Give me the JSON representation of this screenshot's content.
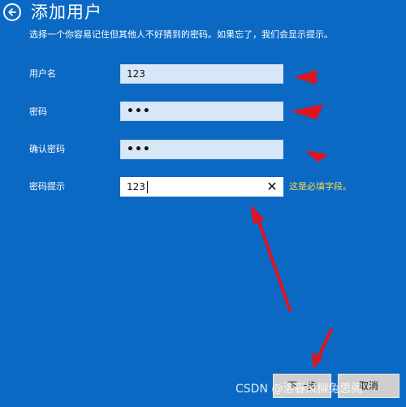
{
  "header": {
    "back_icon": "arrow-left-icon",
    "title": "添加用户",
    "subtitle": "选择一个你容易记住但其他人不好猜到的密码。如果忘了，我们会显示提示。"
  },
  "form": {
    "username": {
      "label": "用户名",
      "value": "123"
    },
    "password": {
      "label": "密码",
      "value": "•••"
    },
    "confirm_password": {
      "label": "确认密码",
      "value": "•••"
    },
    "hint": {
      "label": "密码提示",
      "value": "123",
      "clear_icon": "close-icon"
    },
    "required_note": "这是必填字段。"
  },
  "buttons": {
    "next_label": "下一步",
    "cancel_label": "取消"
  },
  "watermark": "CSDN @洛春风柳兔思阁",
  "annotation_color": "#e0141e"
}
